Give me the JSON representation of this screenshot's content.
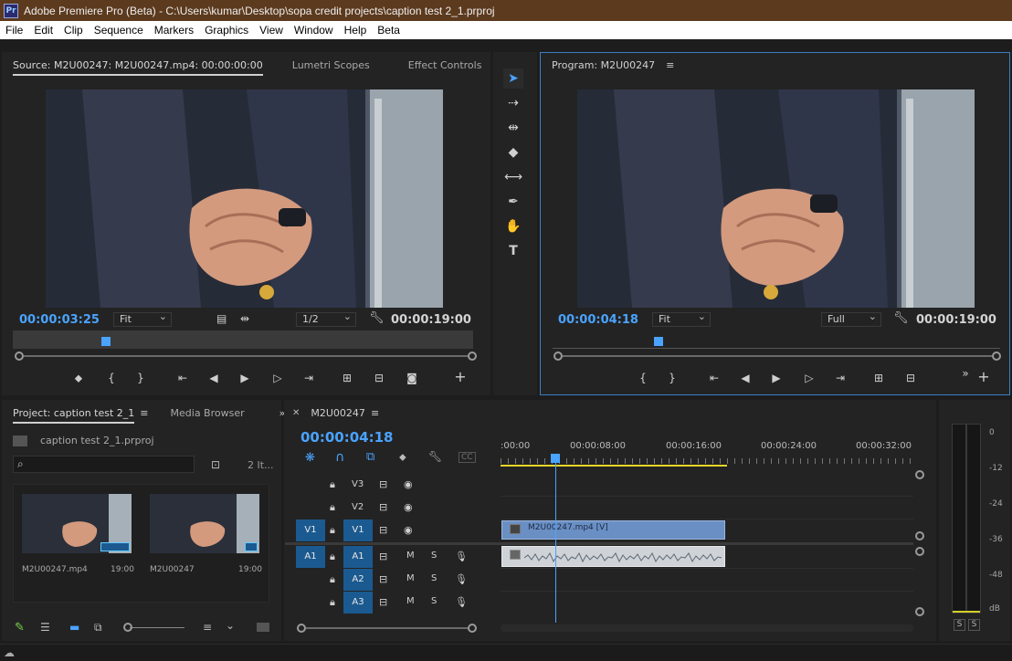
{
  "window": {
    "title": "Adobe Premiere Pro (Beta) - C:\\Users\\kumar\\Desktop\\sopa credit projects\\caption test 2_1.prproj",
    "app_icon": "Pr"
  },
  "menu": [
    "File",
    "Edit",
    "Clip",
    "Sequence",
    "Markers",
    "Graphics",
    "View",
    "Window",
    "Help",
    "Beta"
  ],
  "source_panel": {
    "tabs": [
      "Source: M2U00247: M2U00247.mp4: 00:00:00:00",
      "Lumetri Scopes",
      "Effect Controls"
    ],
    "timecode": "00:00:03:25",
    "zoom": "Fit",
    "resolution": "1/2",
    "duration": "00:00:19:00"
  },
  "program_panel": {
    "title": "Program: M2U00247",
    "timecode": "00:00:04:18",
    "zoom": "Fit",
    "resolution": "Full",
    "duration": "00:00:19:00"
  },
  "project_panel": {
    "tabs": [
      "Project: caption test 2_1",
      "Media Browser"
    ],
    "file": "caption test 2_1.prproj",
    "item_count": "2 It...",
    "items": [
      {
        "name": "M2U00247.mp4",
        "duration": "19:00"
      },
      {
        "name": "M2U00247",
        "duration": "19:00"
      }
    ]
  },
  "timeline": {
    "sequence": "M2U00247",
    "timecode": "00:00:04:18",
    "ruler": [
      ":00:00",
      "00:00:08:00",
      "00:00:16:00",
      "00:00:24:00",
      "00:00:32:00"
    ],
    "video_tracks": [
      "V3",
      "V2",
      "V1"
    ],
    "audio_tracks": [
      "A1",
      "A2",
      "A3"
    ],
    "source_patch_v": "V1",
    "source_patch_a": "A1",
    "m_label": "M",
    "s_label": "S",
    "cc_label": "CC",
    "video_clip": "M2U00247.mp4 [V]"
  },
  "meter": {
    "labels": [
      "0",
      "-12",
      "-24",
      "-36",
      "-48",
      "dB"
    ],
    "solo": [
      "S",
      "S"
    ]
  },
  "colors": {
    "accent": "#4aa3ff",
    "titlebar": "#5c3a1e",
    "track_patch": "#1b5a90",
    "video_clip": "#6a8fc4",
    "audio_clip": "#cfd3d8"
  }
}
